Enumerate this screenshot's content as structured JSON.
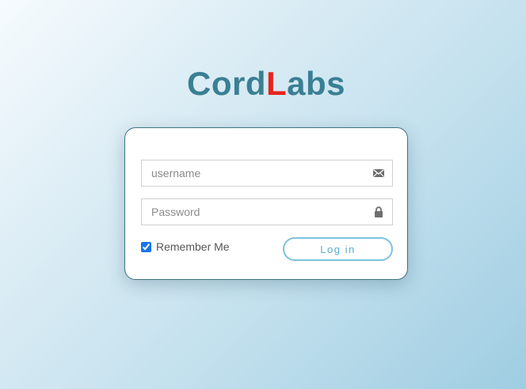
{
  "brand": {
    "name_part1": "Cord",
    "name_accent": "L",
    "name_part2": "abs",
    "accent_color": "#e8231b",
    "primary_color": "#3a7f94"
  },
  "login_form": {
    "username": {
      "placeholder": "username",
      "value": "",
      "icon": "envelope-icon"
    },
    "password": {
      "placeholder": "Password",
      "value": "",
      "icon": "lock-icon"
    },
    "remember_me": {
      "label": "Remember Me",
      "checked": true
    },
    "submit_label": "Log in"
  }
}
